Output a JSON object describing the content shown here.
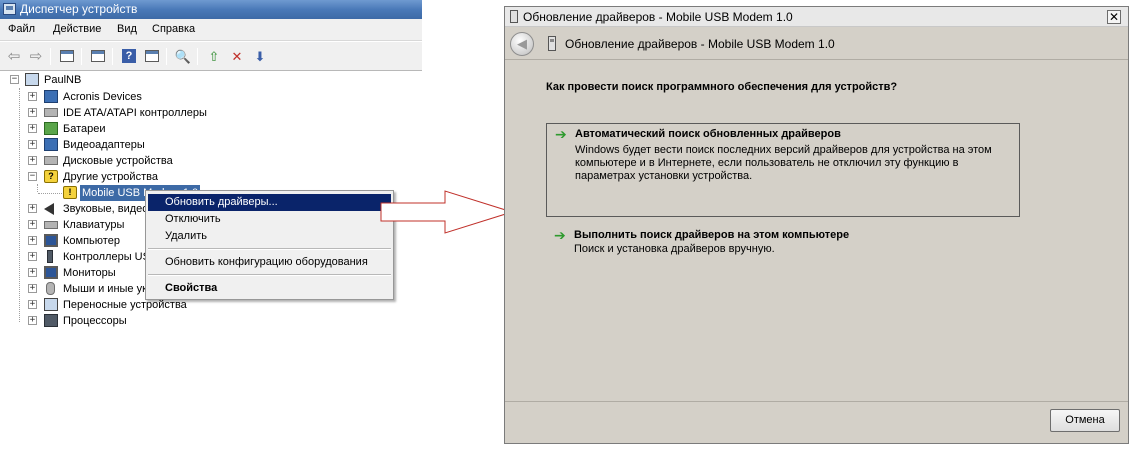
{
  "device_manager": {
    "title": "Диспетчер устройств",
    "menu": [
      "Файл",
      "Действие",
      "Вид",
      "Справка"
    ],
    "tree": {
      "root": "PaulNB",
      "items": [
        "Acronis Devices",
        "IDE ATA/ATAPI контроллеры",
        "Батареи",
        "Видеоадаптеры",
        "Дисковые устройства",
        "Другие устройства",
        "Mobile USB Modem 1.0",
        "Звуковые, видео и игровые устройства",
        "Клавиатуры",
        "Компьютер",
        "Контроллеры USB",
        "Мониторы",
        "Мыши и иные указывающие устройства",
        "Переносные устройства",
        "Процессоры"
      ]
    }
  },
  "context_menu": {
    "items": [
      "Обновить драйверы...",
      "Отключить",
      "Удалить",
      "Обновить конфигурацию оборудования",
      "Свойства"
    ]
  },
  "dialog": {
    "title": "Обновление драйверов - Mobile USB Modem 1.0",
    "header_title": "Обновление драйверов - Mobile USB Modem 1.0",
    "question": "Как провести поиск программного обеспечения для устройств?",
    "option_auto": {
      "title": "Автоматический поиск обновленных драйверов",
      "desc": "Windows будет вести поиск последних версий драйверов для устройства на этом компьютере и в Интернете, если пользователь не отключил эту функцию в параметрах установки устройства."
    },
    "option_manual": {
      "title": "Выполнить поиск драйверов на этом компьютере",
      "desc": "Поиск и установка драйверов вручную."
    },
    "cancel": "Отмена",
    "close_glyph": "✕",
    "back_glyph": "◀"
  },
  "colors": {
    "titlebar": "#4a79b8",
    "menu_highlight": "#0a246a",
    "arrow": "#c0302a",
    "option_arrow": "#2e9a2e"
  }
}
